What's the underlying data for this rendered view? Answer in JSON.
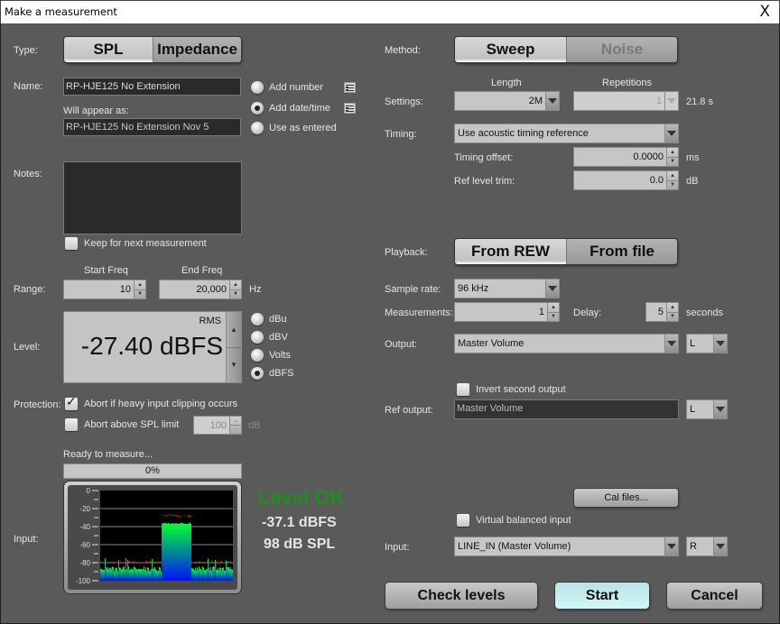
{
  "window": {
    "title": "Make a measurement",
    "close_label": "X"
  },
  "left": {
    "type": {
      "label": "Type:",
      "options": [
        "SPL",
        "Impedance"
      ],
      "selected": "SPL"
    },
    "name": {
      "label": "Name:",
      "value": "RP-HJE125 No Extension",
      "will_appear_label": "Will appear as:",
      "will_appear_value": "RP-HJE125 No Extension Nov 5",
      "options": [
        {
          "label": "Add number",
          "checked": false
        },
        {
          "label": "Add date/time",
          "checked": true
        },
        {
          "label": "Use as entered",
          "checked": false
        }
      ]
    },
    "notes": {
      "label": "Notes:",
      "value": "",
      "keep_label": "Keep for next measurement",
      "keep_checked": false
    },
    "range": {
      "label": "Range:",
      "start_label": "Start Freq",
      "start_value": "10",
      "end_label": "End Freq",
      "end_value": "20,000",
      "unit": "Hz"
    },
    "level": {
      "label": "Level:",
      "rms_label": "RMS",
      "value": "-27.40 dBFS",
      "units": [
        {
          "label": "dBu",
          "checked": false
        },
        {
          "label": "dBV",
          "checked": false
        },
        {
          "label": "Volts",
          "checked": false
        },
        {
          "label": "dBFS",
          "checked": true
        }
      ]
    },
    "protection": {
      "label": "Protection:",
      "abort_clipping_label": "Abort if heavy input clipping occurs",
      "abort_clipping_checked": true,
      "abort_spl_label": "Abort above SPL limit",
      "abort_spl_checked": false,
      "spl_limit": "100",
      "spl_unit": "dB"
    },
    "status": {
      "text": "Ready to measure...",
      "progress": "0%",
      "progress_fraction": 0
    },
    "input": {
      "label": "Input:",
      "meter_ticks": [
        "0",
        "-20",
        "-40",
        "-60",
        "-80",
        "-100"
      ],
      "level_status": "Level OK",
      "level_dbfs": "-37.1 dBFS",
      "level_spl": "98 dB SPL",
      "colors": {
        "ok": "#1e8f1e",
        "peak": "#e02020",
        "high": "#00ff30",
        "low": "#0010ff"
      }
    }
  },
  "right": {
    "method": {
      "label": "Method:",
      "options": [
        "Sweep",
        "Noise"
      ],
      "selected": "Sweep"
    },
    "settings": {
      "label": "Settings:",
      "length_label": "Length",
      "length_value": "2M",
      "reps_label": "Repetitions",
      "reps_value": "1",
      "duration": "21.8 s"
    },
    "timing": {
      "label": "Timing:",
      "value": "Use acoustic timing reference",
      "offset_label": "Timing offset:",
      "offset_value": "0.0000",
      "offset_unit": "ms",
      "trim_label": "Ref level trim:",
      "trim_value": "0.0",
      "trim_unit": "dB"
    },
    "playback": {
      "label": "Playback:",
      "options": [
        "From REW",
        "From file"
      ],
      "selected": "From REW"
    },
    "sample_rate": {
      "label": "Sample rate:",
      "value": "96 kHz"
    },
    "measurements": {
      "label": "Measurements:",
      "value": "1",
      "delay_label": "Delay:",
      "delay_value": "5",
      "delay_unit": "seconds"
    },
    "output": {
      "label": "Output:",
      "value": "Master Volume",
      "channel": "L"
    },
    "invert": {
      "label": "Invert second output",
      "checked": false
    },
    "ref_output": {
      "label": "Ref output:",
      "value": "Master Volume",
      "channel": "L"
    },
    "cal_files_label": "Cal files...",
    "virtual_balanced": {
      "label": "Virtual balanced input",
      "checked": false
    },
    "input": {
      "label": "Input:",
      "value": "LINE_IN (Master Volume)",
      "channel": "R"
    }
  },
  "footer": {
    "check_levels": "Check levels",
    "start": "Start",
    "cancel": "Cancel"
  }
}
